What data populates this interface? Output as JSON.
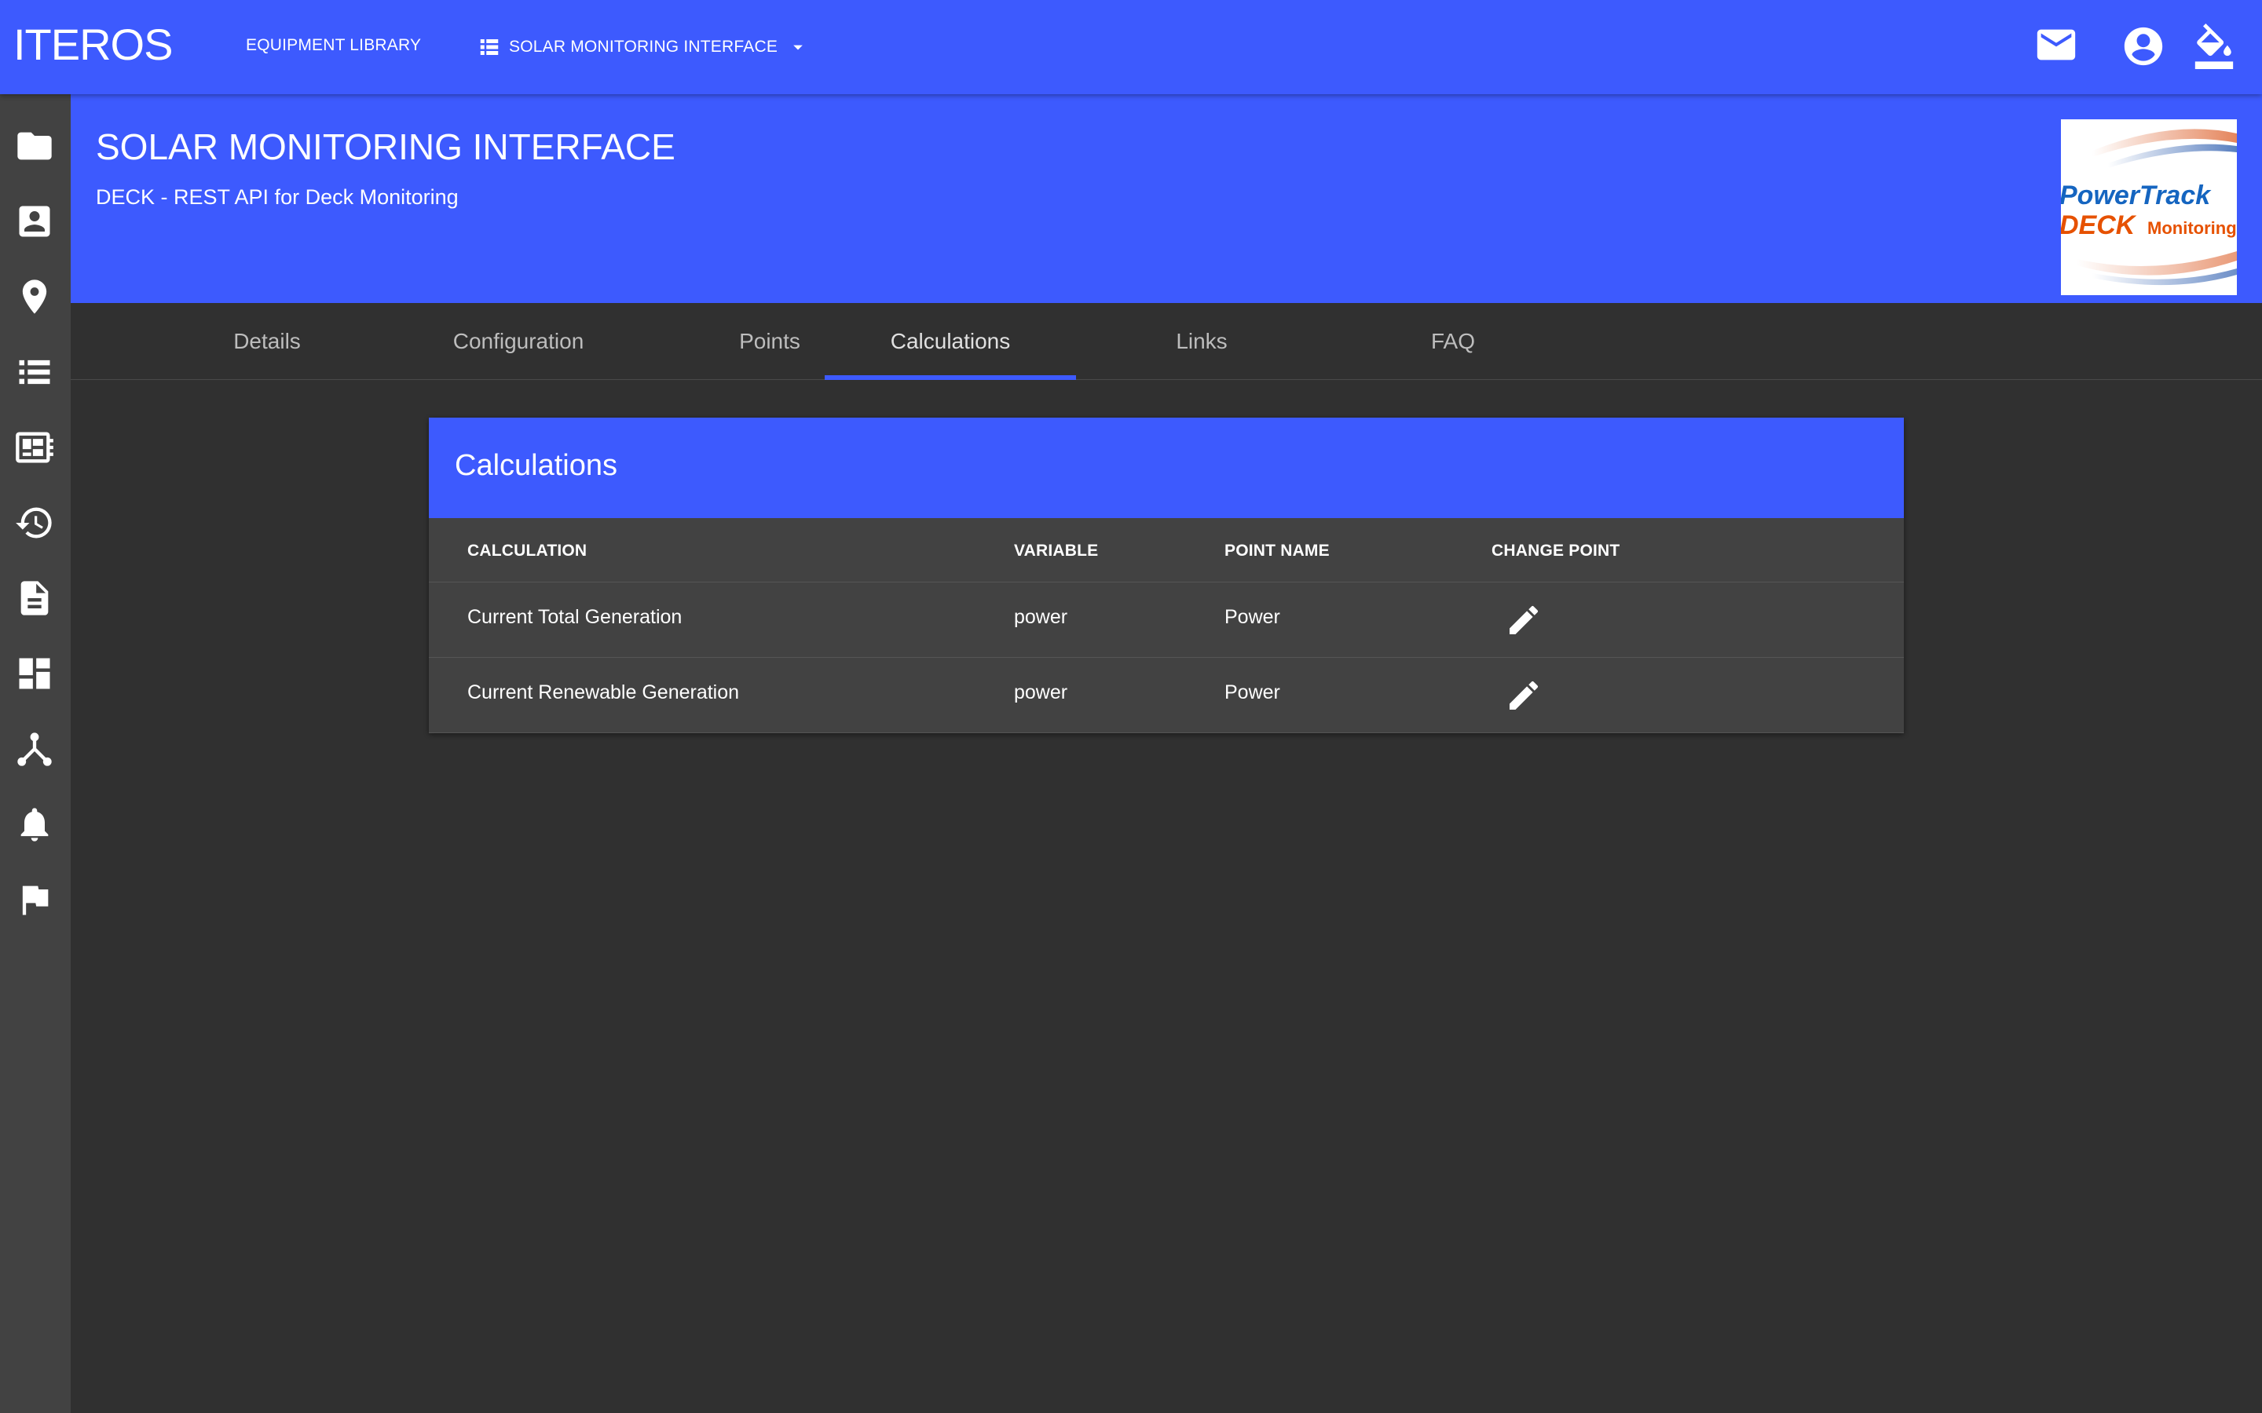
{
  "appbar": {
    "brand": "ITEROS",
    "nav": {
      "equipment_library": "EQUIPMENT LIBRARY",
      "solar_interface": "SOLAR MONITORING INTERFACE"
    },
    "icons": [
      "mail-icon",
      "account-circle-icon",
      "paint-bucket-icon"
    ]
  },
  "sidebar": {
    "items": [
      {
        "icon": "folder-icon"
      },
      {
        "icon": "contact-card-icon"
      },
      {
        "icon": "location-pin-icon"
      },
      {
        "icon": "list-icon"
      },
      {
        "icon": "dashboard-card-icon"
      },
      {
        "icon": "history-icon"
      },
      {
        "icon": "document-icon"
      },
      {
        "icon": "dashboard-grid-icon"
      },
      {
        "icon": "network-icon"
      },
      {
        "icon": "bell-icon"
      },
      {
        "icon": "flag-icon"
      }
    ]
  },
  "header": {
    "title": "SOLAR MONITORING INTERFACE",
    "subtitle": "DECK - REST API for Deck Monitoring",
    "logo_text": {
      "line1": "PowerTrack",
      "line2_a": "DECK",
      "line2_b": "Monitoring"
    }
  },
  "tabs": [
    {
      "label": "Details",
      "active": false
    },
    {
      "label": "Configuration",
      "active": false
    },
    {
      "label": "Points",
      "active": false
    },
    {
      "label": "Calculations",
      "active": true
    },
    {
      "label": "Links",
      "active": false
    },
    {
      "label": "FAQ",
      "active": false
    }
  ],
  "calculations": {
    "title": "Calculations",
    "columns": [
      "CALCULATION",
      "VARIABLE",
      "POINT NAME",
      "CHANGE POINT"
    ],
    "rows": [
      {
        "calculation": "Current Total Generation",
        "variable": "power",
        "point_name": "Power"
      },
      {
        "calculation": "Current Renewable Generation",
        "variable": "power",
        "point_name": "Power"
      }
    ]
  },
  "colors": {
    "accent": "#3d5afe",
    "background": "#303030",
    "sidebar": "#424242",
    "card": "#424242",
    "logo_blue": "#1565c0",
    "logo_orange": "#e65100"
  }
}
